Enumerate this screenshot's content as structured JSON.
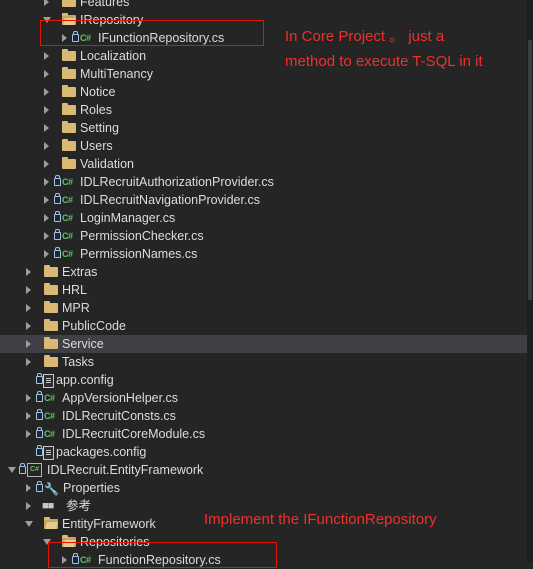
{
  "tree": [
    {
      "name": "Features",
      "type": "folder",
      "arrow": "right",
      "lock": false
    },
    {
      "name": "IRepository",
      "type": "folder-open",
      "arrow": "down",
      "lock": false
    },
    {
      "name": "IFunctionRepository.cs",
      "type": "cs",
      "arrow": "right",
      "lock": true
    },
    {
      "name": "Localization",
      "type": "folder",
      "arrow": "right",
      "lock": false
    },
    {
      "name": "MultiTenancy",
      "type": "folder",
      "arrow": "right",
      "lock": false
    },
    {
      "name": "Notice",
      "type": "folder",
      "arrow": "right",
      "lock": false
    },
    {
      "name": "Roles",
      "type": "folder",
      "arrow": "right",
      "lock": false
    },
    {
      "name": "Setting",
      "type": "folder",
      "arrow": "right",
      "lock": false
    },
    {
      "name": "Users",
      "type": "folder",
      "arrow": "right",
      "lock": false
    },
    {
      "name": "Validation",
      "type": "folder",
      "arrow": "right",
      "lock": false
    },
    {
      "name": "IDLRecruitAuthorizationProvider.cs",
      "type": "cs",
      "arrow": "right",
      "lock": true
    },
    {
      "name": "IDLRecruitNavigationProvider.cs",
      "type": "cs",
      "arrow": "right",
      "lock": true
    },
    {
      "name": "LoginManager.cs",
      "type": "cs",
      "arrow": "right",
      "lock": true
    },
    {
      "name": "PermissionChecker.cs",
      "type": "cs",
      "arrow": "right",
      "lock": true
    },
    {
      "name": "PermissionNames.cs",
      "type": "cs",
      "arrow": "right",
      "lock": true
    },
    {
      "name": "Extras",
      "type": "folder",
      "arrow": "right",
      "lock": false
    },
    {
      "name": "HRL",
      "type": "folder",
      "arrow": "right",
      "lock": false
    },
    {
      "name": "MPR",
      "type": "folder",
      "arrow": "right",
      "lock": false
    },
    {
      "name": "PublicCode",
      "type": "folder",
      "arrow": "right",
      "lock": false
    },
    {
      "name": "Service",
      "type": "folder",
      "arrow": "right",
      "lock": false,
      "selected": true
    },
    {
      "name": "Tasks",
      "type": "folder",
      "arrow": "right",
      "lock": false
    },
    {
      "name": "app.config",
      "type": "config",
      "arrow": "none",
      "lock": true
    },
    {
      "name": "AppVersionHelper.cs",
      "type": "cs",
      "arrow": "right",
      "lock": true
    },
    {
      "name": "IDLRecruitConsts.cs",
      "type": "cs",
      "arrow": "right",
      "lock": true
    },
    {
      "name": "IDLRecruitCoreModule.cs",
      "type": "cs",
      "arrow": "right",
      "lock": true
    },
    {
      "name": "packages.config",
      "type": "config",
      "arrow": "none",
      "lock": true
    },
    {
      "name": "IDLRecruit.EntityFramework",
      "type": "project",
      "arrow": "down",
      "lock": true
    },
    {
      "name": "Properties",
      "type": "wrench",
      "arrow": "right",
      "lock": true
    },
    {
      "name": "参考",
      "type": "references",
      "arrow": "right",
      "lock": false
    },
    {
      "name": "EntityFramework",
      "type": "folder-open",
      "arrow": "down",
      "lock": false
    },
    {
      "name": "Repositories",
      "type": "folder-open",
      "arrow": "down",
      "lock": false
    },
    {
      "name": "FunctionRepository.cs",
      "type": "cs",
      "arrow": "right",
      "lock": true
    }
  ],
  "annotations": {
    "core_note_line1": "In Core Project 。 just a",
    "core_note_line2": "method to execute T-SQL in it",
    "ef_note": "Implement the IFunctionRepository"
  },
  "icons": {
    "cs_glyph": "C#",
    "project_glyph": "C#",
    "wrench_glyph": "🔧",
    "references_glyph": "■■"
  },
  "colors": {
    "background": "#252526",
    "selected_row": "#3f3f46",
    "annotation_red": "#f0302a",
    "cs_green": "#6abf69",
    "folder_yellow": "#d9b974"
  }
}
